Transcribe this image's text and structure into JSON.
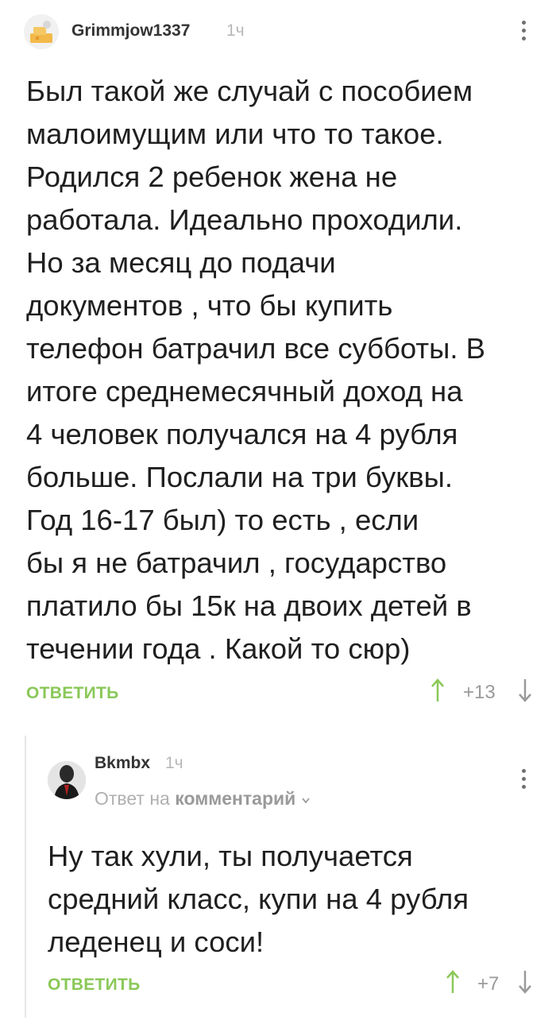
{
  "comment": {
    "username": "Grimmjow1337",
    "time": "1ч",
    "lines": [
      "Был такой же случай с пособием",
      "малоимущим или что то такое.",
      "Родился 2 ребенок жена не",
      "работала. Идеально проходили.",
      "Но за месяц до подачи",
      "документов , что бы купить",
      "телефон батрачил все субботы. В",
      "итоге среднемесячный доход на",
      "4 человек получался на 4 рубля",
      "больше. Послали на три буквы.",
      "Год 16-17 был) то есть , если",
      "бы я не батрачил , государство",
      "платило бы 15к на двоих детей в",
      "течении года . Какой то сюр)"
    ],
    "reply_label": "ОТВЕТИТЬ",
    "score": "+13"
  },
  "reply": {
    "username": "Bkmbx",
    "time": "1ч",
    "reply_prefix": "Ответ на",
    "reply_target": "комментарий",
    "lines": [
      "Ну так хули, ты получается",
      "средний класс, купи на 4 рубля",
      "леденец и соси!"
    ],
    "reply_label": "ОТВЕТИТЬ",
    "score": "+7"
  },
  "icons": {
    "upvote": "arrow-up",
    "downvote": "arrow-down",
    "menu": "kebab-menu",
    "expand": "chevron-down"
  },
  "colors": {
    "accent": "#8ac858",
    "muted": "#9a9a9a"
  }
}
